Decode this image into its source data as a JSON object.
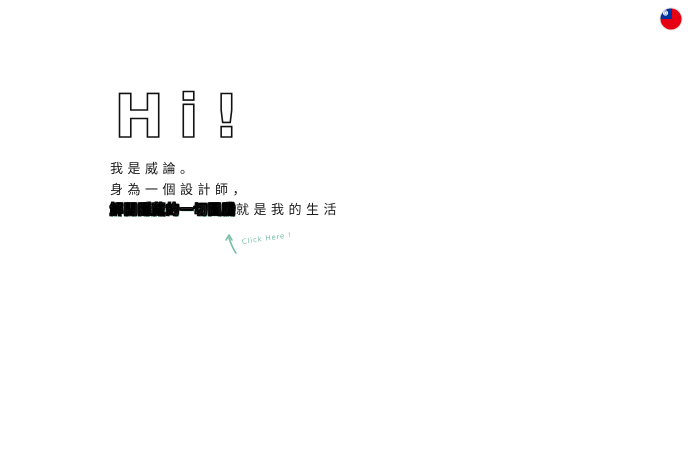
{
  "hero": {
    "title": "Hi!",
    "lines": [
      "我是威論。",
      "身為一個設計師，"
    ],
    "highlight_text": "解開隱藏的一切圖騰",
    "suffix_text": "就是我的生活"
  },
  "hint": {
    "label": "Click Here !",
    "arrow_icon": "curved-arrow-up-icon"
  },
  "language_toggle": {
    "icon": "taiwan-flag-icon"
  },
  "colors": {
    "accent": "#77bca8",
    "text": "#1a1a1a",
    "flag_red": "#e60012",
    "flag_blue": "#0033a0"
  }
}
